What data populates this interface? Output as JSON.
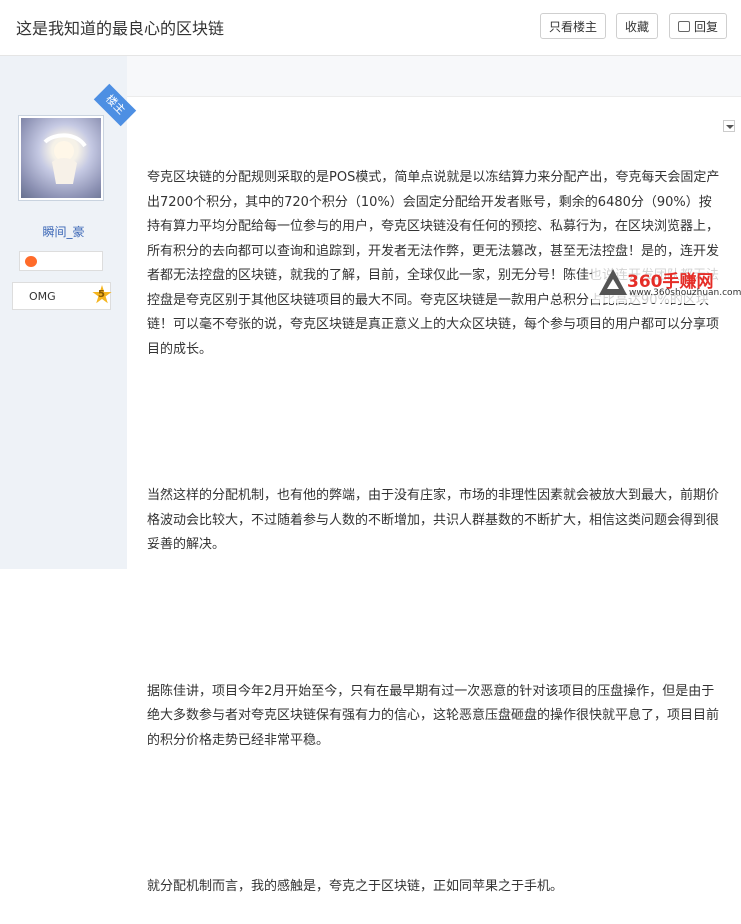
{
  "header": {
    "title": "这是我知道的最良心的区块链",
    "buttons": {
      "only_author": "只看楼主",
      "favorite": "收藏",
      "reply": "回复"
    }
  },
  "author": {
    "name": "瞬间_豪",
    "badge": "楼主",
    "rank_text": "OMG",
    "rank_level": "5"
  },
  "post": {
    "paragraphs": [
      "夸克区块链的分配规则采取的是POS模式，简单点说就是以冻结算力来分配产出，夸克每天会固定产出7200个积分，其中的720个积分（10%）会固定分配给开发者账号，剩余的6480分（90%）按持有算力平均分配给每一位参与的用户，夸克区块链没有任何的预挖、私募行为，在区块浏览器上，所有积分的去向都可以查询和追踪到，开发者无法作弊，更无法篡改，甚至无法控盘！是的，连开发者都无法控盘的区块链，就我的了解，目前，全球仅此一家，别无分号！陈佳也说连开发团队都无法控盘是夸克区别于其他区块链项目的最大不同。夸克区块链是一款用户总积分占比高达90%的区块链！可以毫不夸张的说，夸克区块链是真正意义上的大众区块链，每个参与项目的用户都可以分享项目的成长。",
      "当然这样的分配机制，也有他的弊端，由于没有庄家，市场的非理性因素就会被放大到最大，前期价格波动会比较大，不过随着参与人数的不断增加，共识人群基数的不断扩大，相信这类问题会得到很妥善的解决。",
      "据陈佳讲，项目今年2月开始至今，只有在最早期有过一次恶意的针对该项目的压盘操作，但是由于绝大多数参与者对夸克区块链保有强有力的信心，这轮恶意压盘砸盘的操作很快就平息了，项目目前的积分价格走势已经非常平稳。",
      "就分配机制而言，我的感触是，夸克之于区块链，正如同苹果之于手机。"
    ]
  },
  "watermark": {
    "title": "360手赚网",
    "url": "www.360shouzhuan.com"
  }
}
